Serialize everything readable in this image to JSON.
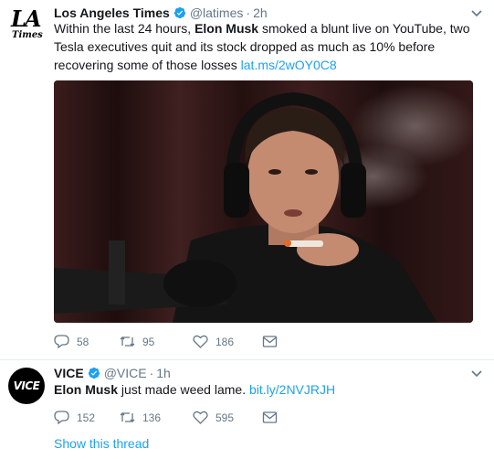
{
  "tweets": [
    {
      "name": "Los Angeles Times",
      "handle": "@latimes",
      "separator": "·",
      "time": "2h",
      "text": {
        "pre": "Within the last 24 hours, ",
        "bold": "Elon Musk",
        "post": " smoked a blunt live on YouTube, two Tesla executives quit and its stock dropped as much as 10% before recovering some of those losses ",
        "link": "lat.ms/2wOY0C8"
      },
      "avatar": {
        "line1": "LA",
        "line2": "Times"
      },
      "media_alt": "",
      "stats": {
        "replies": "58",
        "retweets": "95",
        "likes": "186"
      }
    },
    {
      "name": "VICE",
      "handle": "@VICE",
      "separator": "·",
      "time": "1h",
      "text": {
        "pre": "",
        "bold": "Elon Musk",
        "post": " just made weed lame. ",
        "link": "bit.ly/2NVJRJH"
      },
      "avatar": {
        "line1": "VICE"
      },
      "stats": {
        "replies": "152",
        "retweets": "136",
        "likes": "595"
      }
    }
  ],
  "show_thread": "Show this thread",
  "colors": {
    "link": "#1da1f2",
    "muted": "#657786",
    "verified": "#1da1f2"
  },
  "icons": [
    "verified-badge-icon",
    "caret-down-icon",
    "reply-icon",
    "retweet-icon",
    "like-icon",
    "direct-message-icon"
  ]
}
